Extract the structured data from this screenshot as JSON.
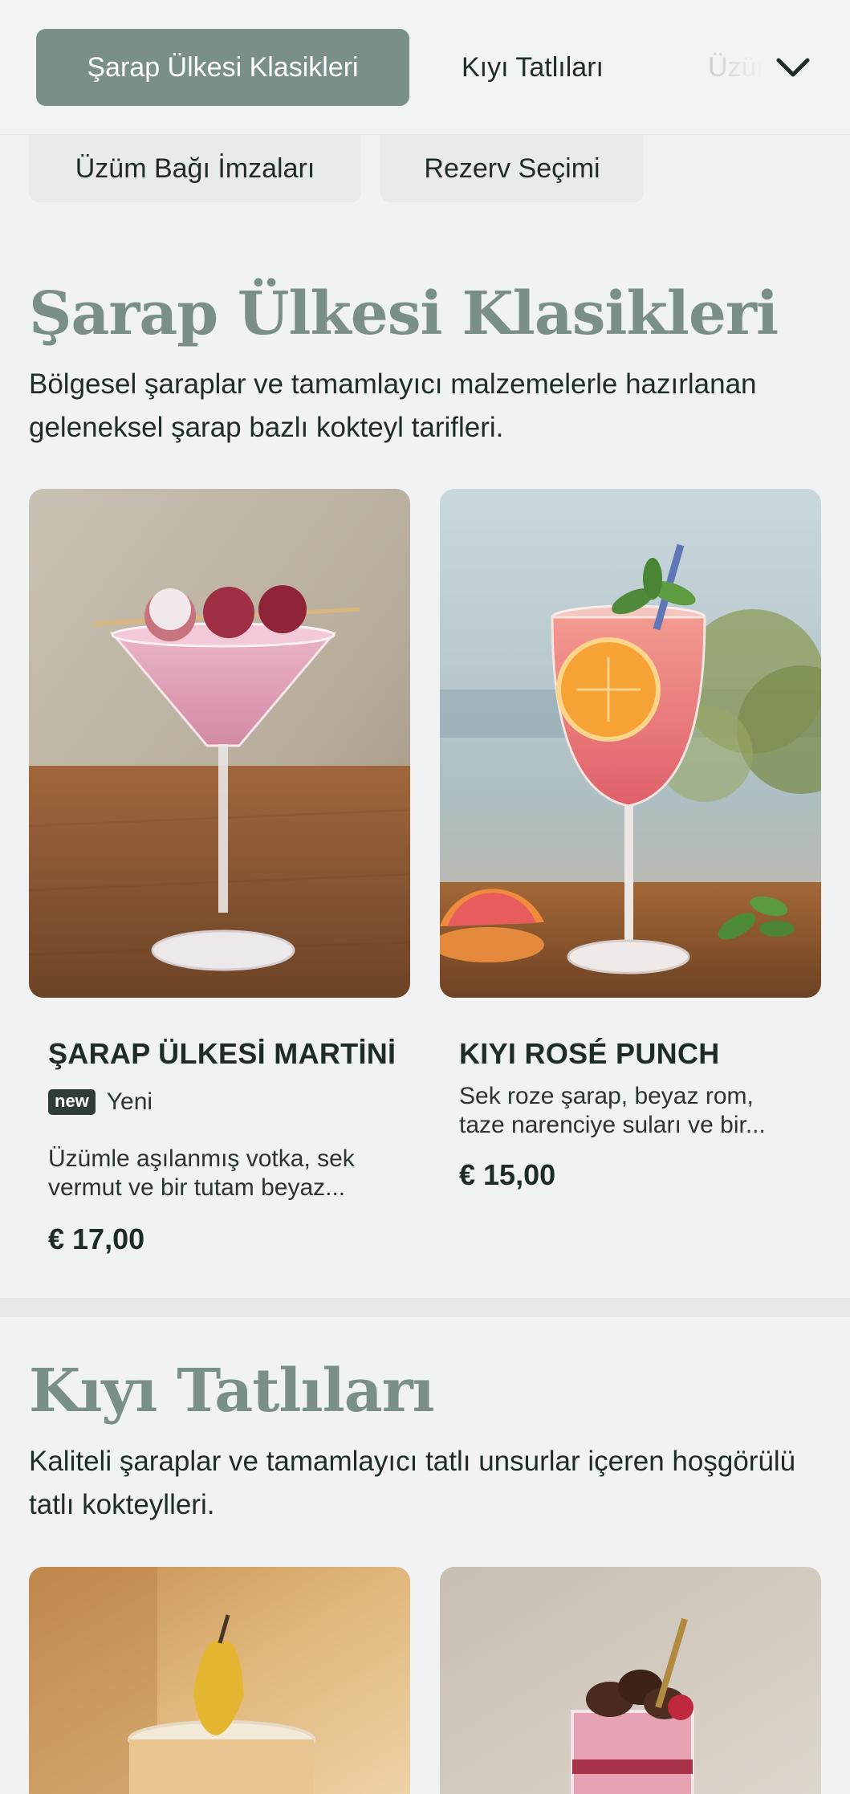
{
  "nav": {
    "tabs": [
      {
        "label": "Şarap Ülkesi Klasikleri",
        "active": true
      },
      {
        "label": "Kıyı Tatlıları",
        "active": false
      },
      {
        "label": "Üzüm Bağı İmzaları",
        "active": false
      }
    ],
    "overflow_icon": "chevron-down-icon",
    "pills": [
      {
        "label": "Üzüm Bağı İmzaları"
      },
      {
        "label": "Rezerv Seçimi"
      }
    ]
  },
  "sections": [
    {
      "title": "Şarap Ülkesi Klasikleri",
      "description": "Bölgesel şaraplar ve tamamlayıcı malzemelerle hazırlanan geleneksel şarap bazlı kokteyl tarifleri.",
      "items": [
        {
          "name": "ŞARAP ÜLKESİ MARTİNİ",
          "badge": "new",
          "badge_label": "Yeni",
          "description": "Üzümle aşılanmış votka, sek vermut ve bir tutam beyaz...",
          "price": "€ 17,00"
        },
        {
          "name": "KIYI ROSÉ PUNCH",
          "description": "Sek roze şarap, beyaz rom, taze narenciye suları ve bir...",
          "price": "€ 15,00"
        }
      ]
    },
    {
      "title": "Kıyı Tatlıları",
      "description": "Kaliteli şaraplar ve tamamlayıcı tatlı unsurlar içeren hoşgörülü tatlı kokteylleri.",
      "items": []
    }
  ],
  "colors": {
    "accent": "#7a8e8b",
    "background": "#f0f2f4",
    "text": "#1f2b2a",
    "badge": "#2f3c3a"
  }
}
